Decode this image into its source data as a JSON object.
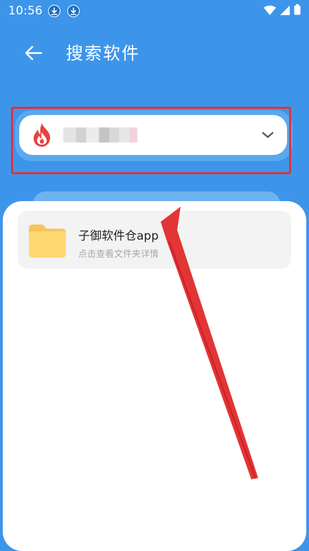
{
  "status_bar": {
    "time": "10:56"
  },
  "header": {
    "title": "搜索软件"
  },
  "selector": {
    "app_name_hidden": true
  },
  "results": [
    {
      "title": "子御软件仓app",
      "subtitle": "点击查看文件夹详情"
    }
  ],
  "colors": {
    "primary_blue": "#3d95ea",
    "highlight_red": "#e0323a",
    "folder_yellow": "#ffd873"
  }
}
